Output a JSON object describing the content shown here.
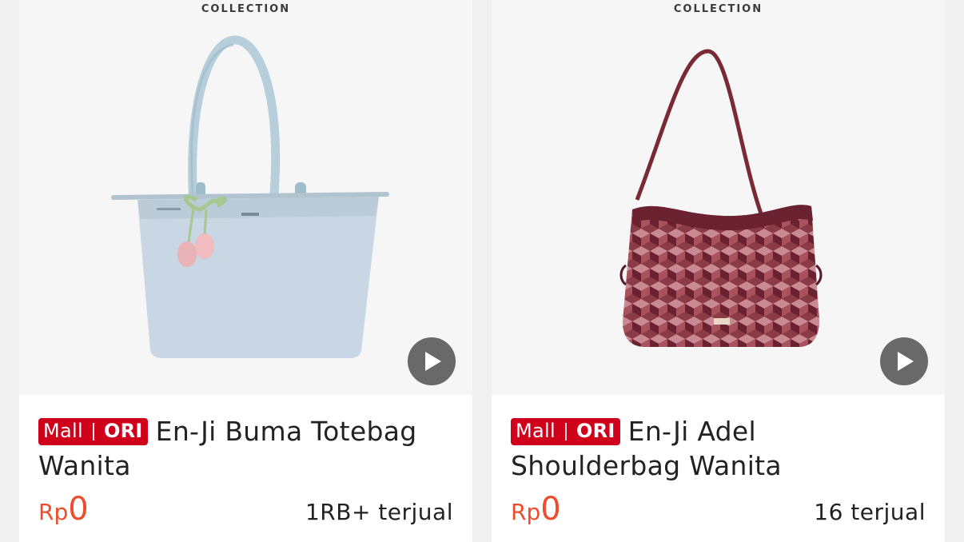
{
  "products": [
    {
      "brand_label": "COLLECTION",
      "badge_mall": "Mall",
      "badge_ori": "ORI",
      "title": "En-Ji Buma Totebag Wanita",
      "currency": "Rp",
      "price": "0",
      "sold": "1RB+ terjual",
      "image_icon": "light-blue-tote-bag-image",
      "color": "#c9d6e3"
    },
    {
      "brand_label": "COLLECTION",
      "badge_mall": "Mall",
      "badge_ori": "ORI",
      "title": "En-Ji Adel Shoulderbag Wanita",
      "currency": "Rp",
      "price": "0",
      "sold": "16 terjual",
      "image_icon": "maroon-shoulder-bag-image",
      "color": "#7a2a33"
    }
  ],
  "colors": {
    "mall_badge": "#d0011b",
    "price": "#ee4d2d",
    "background": "#f0f0f0"
  }
}
